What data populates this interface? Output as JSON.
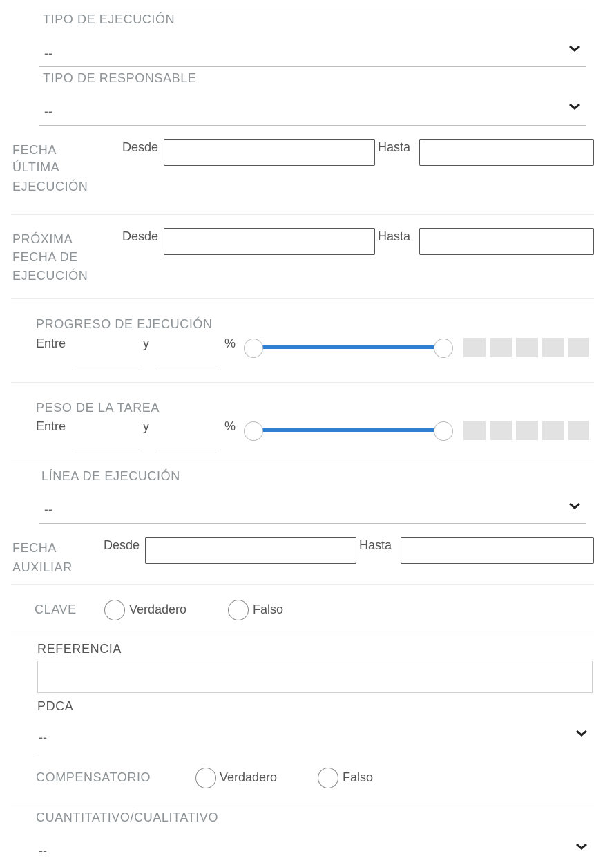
{
  "tipo_ejecucion": {
    "label": "TIPO DE EJECUCIÓN",
    "value": "--"
  },
  "tipo_responsable": {
    "label": "TIPO DE RESPONSABLE",
    "value": "--"
  },
  "fecha_ultima": {
    "label_lines": [
      "FECHA",
      "ÚLTIMA",
      "EJECUCIÓN"
    ],
    "desde": "Desde",
    "hasta": "Hasta",
    "desde_value": "",
    "hasta_value": ""
  },
  "proxima_fecha": {
    "label_lines": [
      "PRÓXIMA",
      "FECHA DE",
      "EJECUCIÓN"
    ],
    "desde": "Desde",
    "hasta": "Hasta",
    "desde_value": "",
    "hasta_value": ""
  },
  "progreso": {
    "label": "PROGRESO DE EJECUCIÓN",
    "entre": "Entre",
    "y": "y",
    "percent": "%",
    "min_value": "",
    "max_value": "",
    "slider_low": 0,
    "slider_high": 100
  },
  "peso": {
    "label": "PESO DE LA TAREA",
    "entre": "Entre",
    "y": "y",
    "percent": "%",
    "min_value": "",
    "max_value": "",
    "slider_low": 0,
    "slider_high": 100
  },
  "linea_ejecucion": {
    "label": "LÍNEA DE EJECUCIÓN",
    "value": "--"
  },
  "fecha_auxiliar": {
    "label_lines": [
      "FECHA",
      "AUXILIAR"
    ],
    "desde": "Desde",
    "hasta": "Hasta",
    "desde_value": "",
    "hasta_value": ""
  },
  "clave": {
    "label": "CLAVE",
    "option_true": "Verdadero",
    "option_false": "Falso"
  },
  "referencia": {
    "label": "REFERENCIA",
    "value": ""
  },
  "pdca": {
    "label": "PDCA",
    "value": "--"
  },
  "compensatorio": {
    "label": "COMPENSATORIO",
    "option_true": "Verdadero",
    "option_false": "Falso"
  },
  "cuantitativo": {
    "label": "CUANTITATIVO/CUALITATIVO",
    "value": "--"
  },
  "icons": {
    "select": "chevron-down-icon"
  },
  "colors": {
    "slider": "#2f7fd2",
    "label": "#8d9396"
  }
}
